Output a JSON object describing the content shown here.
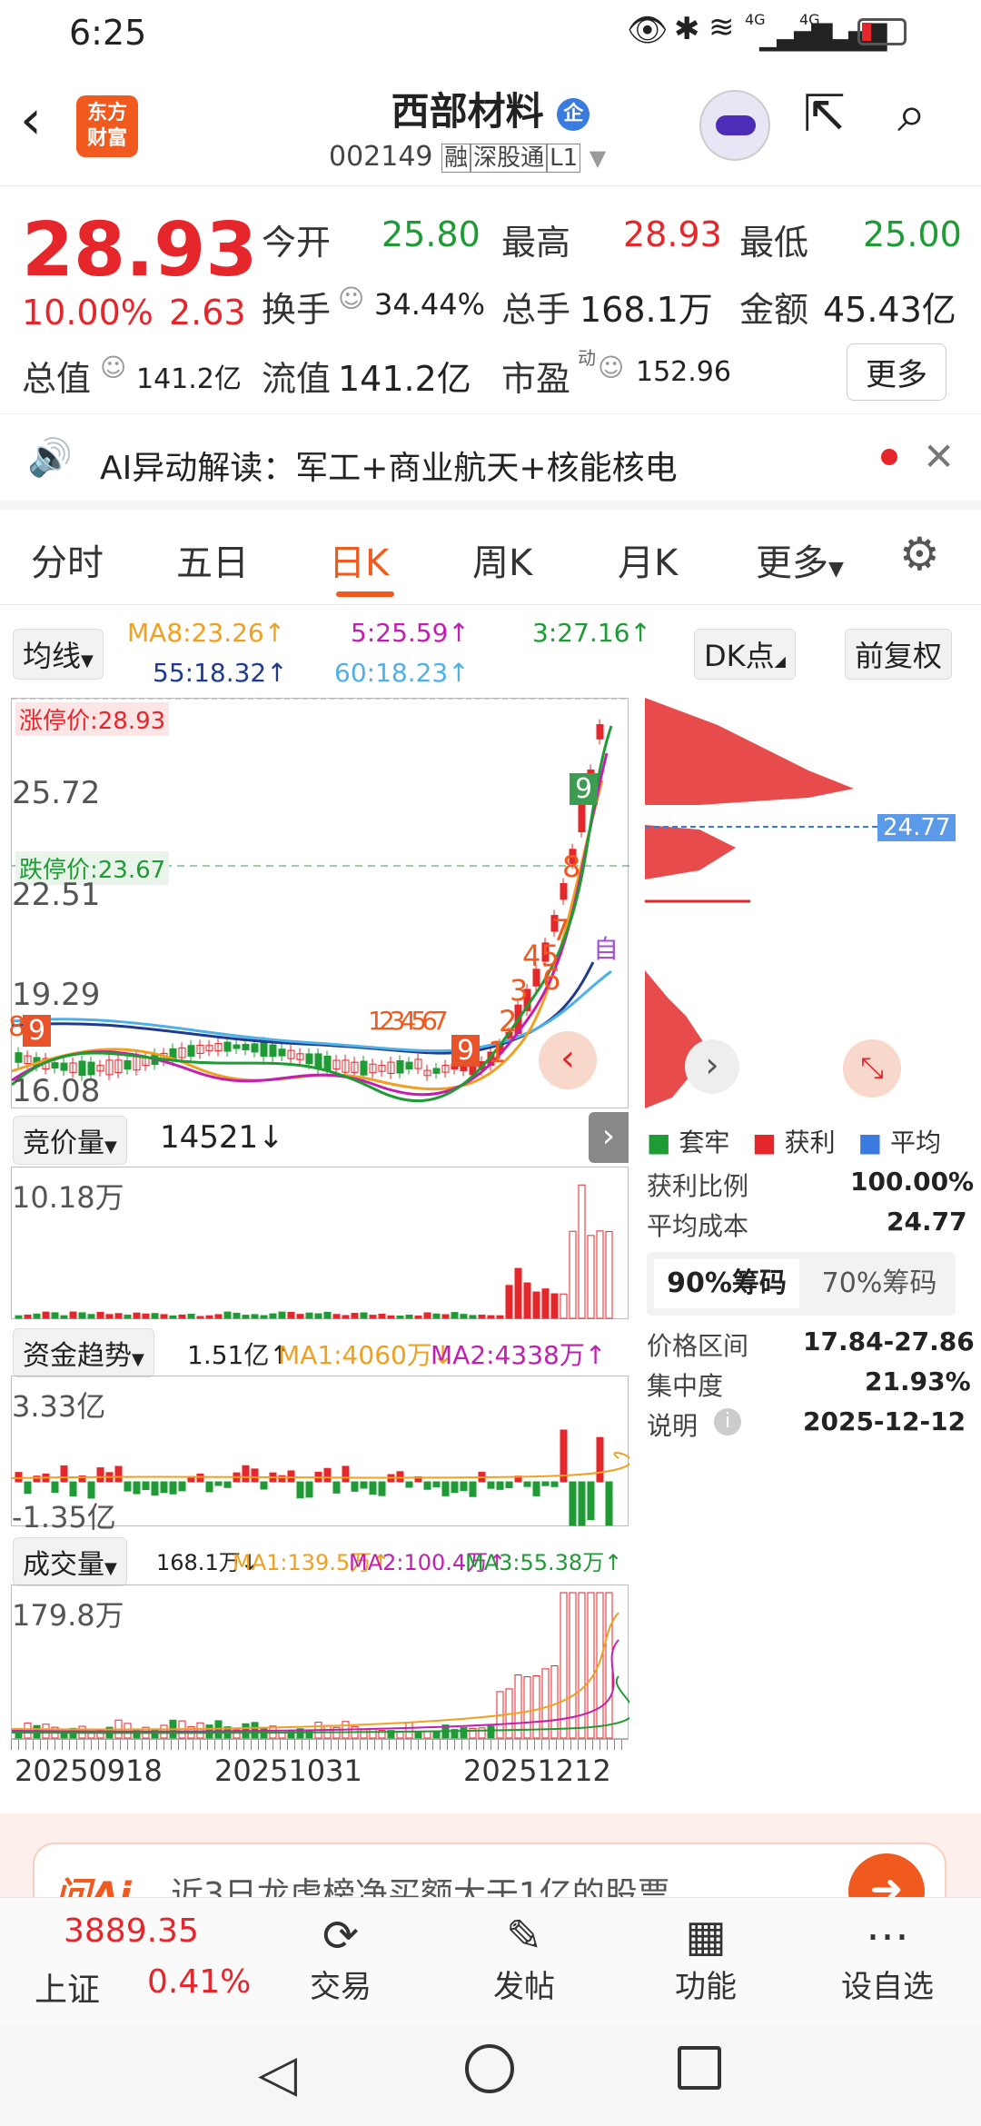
{
  "status_bar": {
    "time": "6:25",
    "net1": "4G",
    "net2": "4G"
  },
  "header": {
    "logo_line1": "东方",
    "logo_line2": "财富",
    "title": "西部材料",
    "title_badge": "企",
    "code": "002149",
    "tag1": "融",
    "tag2": "深股通",
    "tag3": "L1"
  },
  "quote": {
    "price": "28.93",
    "change_pct": "10.00%",
    "change_amt": "2.63",
    "open_label": "今开",
    "open": "25.80",
    "high_label": "最高",
    "high": "28.93",
    "low_label": "最低",
    "low": "25.00",
    "turnover_label": "换手",
    "turnover": "34.44%",
    "vol_label": "总手",
    "vol": "168.1万",
    "amount_label": "金额",
    "amount": "45.43亿",
    "mktcap_label": "总值",
    "mktcap": "141.2亿",
    "float_label": "流值",
    "float": "141.2亿",
    "pe_label": "市盈",
    "pe_sup": "动",
    "pe": "152.96",
    "more": "更多"
  },
  "ai_bar": {
    "text": "AI异动解读：军工+商业航天+核能核电"
  },
  "tabs": [
    {
      "label": "分时"
    },
    {
      "label": "五日"
    },
    {
      "label": "日K",
      "active": true
    },
    {
      "label": "周K"
    },
    {
      "label": "月K"
    },
    {
      "label": "更多"
    }
  ],
  "chart": {
    "ma_select": "均线",
    "ma8": "MA8:23.26↑",
    "ma5": "5:25.59↑",
    "ma3": "3:27.16↑",
    "ma55": "55:18.32↑",
    "ma60": "60:18.23↑",
    "dk_button": "DK点",
    "adjust_button": "前复权",
    "limit_up": "涨停价:28.93",
    "limit_down": "跌停价:23.67",
    "y_ticks": [
      "25.72",
      "22.51",
      "19.29",
      "16.08"
    ],
    "cost_tag": "24.77",
    "seq_marks": [
      "9",
      "8",
      "7",
      "45",
      "6",
      "3",
      "2",
      "1",
      "9",
      "1234567",
      "8",
      "9",
      "自"
    ],
    "auction_select": "竞价量",
    "auction_value": "14521↓",
    "auction_max": "10.18万",
    "fund_select": "资金趋势",
    "fund_value": "1.51亿↑",
    "fund_ma1": "MA1:4060万↓",
    "fund_ma2": "MA2:4338万↑",
    "fund_max": "3.33亿",
    "fund_min": "-1.35亿",
    "vol_select": "成交量",
    "vol_value": "168.1万↓",
    "vol_ma1": "MA1:139.5万↑",
    "vol_ma2": "MA2:100.4万↑",
    "vol_ma3": "MA3:55.38万↑",
    "vol_max": "179.8万",
    "x_dates": [
      "20250918",
      "20251031",
      "20251212"
    ],
    "colors": {
      "up": "#e5262b",
      "down": "#1e9b35",
      "ma3": "#1e9b35",
      "ma5": "#c21fb0",
      "ma8": "#f0a020",
      "ma55": "#1f3a8f",
      "ma60": "#4fb0e8"
    }
  },
  "chip": {
    "legend_trapped": "套牢",
    "legend_profit": "获利",
    "legend_avg": "平均",
    "profit_ratio_label": "获利比例",
    "profit_ratio": "100.00%",
    "avg_cost_label": "平均成本",
    "avg_cost": "24.77",
    "tab90": "90%筹码",
    "tab70": "70%筹码",
    "range_label": "价格区间",
    "range": "17.84-27.86",
    "conc_label": "集中度",
    "conc": "21.93%",
    "note_label": "说明",
    "note": "2025-12-12"
  },
  "promo": {
    "text": "近3日龙虎榜净买额大于1亿的股票"
  },
  "bottom_nav": {
    "index_name": "上证",
    "index_value": "3889.35",
    "index_pct": "0.41%",
    "trade": "交易",
    "post": "发帖",
    "func": "功能",
    "watch": "设自选"
  }
}
